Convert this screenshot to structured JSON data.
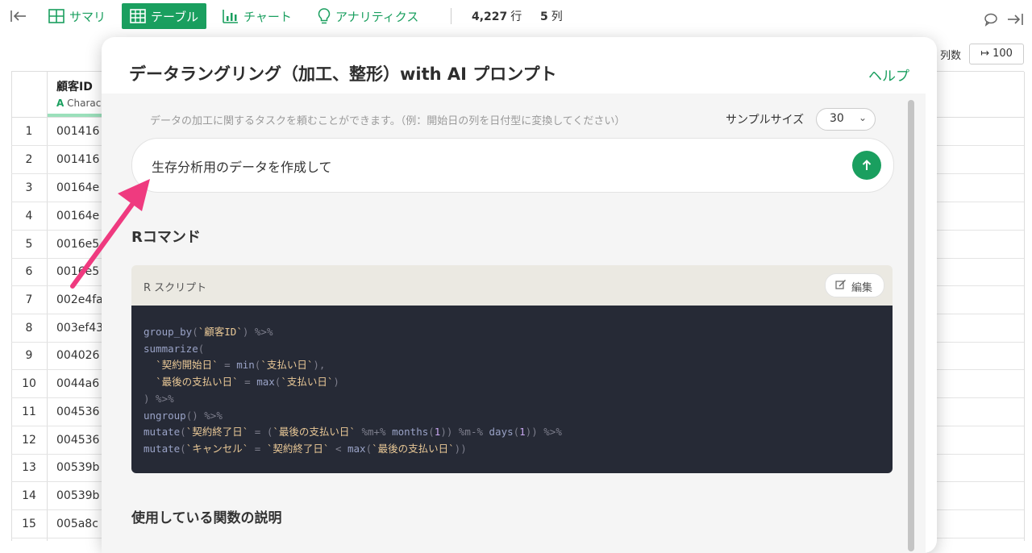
{
  "toolbar": {
    "summary_label": "サマリ",
    "table_label": "テーブル",
    "chart_label": "チャート",
    "analytics_label": "アナリティクス",
    "rows_value": "4,227",
    "rows_unit": "行",
    "cols_value": "5",
    "cols_unit": "列",
    "accent_color": "#1a9f5f"
  },
  "table": {
    "column_header": "顧客ID",
    "column_type": "Charac",
    "column_count_label": "列数",
    "column_count_button": "↦ 100",
    "rows": [
      {
        "num": "1",
        "val": "001416"
      },
      {
        "num": "2",
        "val": "001416"
      },
      {
        "num": "3",
        "val": "00164e"
      },
      {
        "num": "4",
        "val": "00164e"
      },
      {
        "num": "5",
        "val": "0016e5"
      },
      {
        "num": "6",
        "val": "0016e5"
      },
      {
        "num": "7",
        "val": "002e4fa"
      },
      {
        "num": "8",
        "val": "003ef43"
      },
      {
        "num": "9",
        "val": "004026"
      },
      {
        "num": "10",
        "val": "0044a6"
      },
      {
        "num": "11",
        "val": "004536"
      },
      {
        "num": "12",
        "val": "004536"
      },
      {
        "num": "13",
        "val": "00539b"
      },
      {
        "num": "14",
        "val": "00539b"
      },
      {
        "num": "15",
        "val": "005a8c"
      }
    ]
  },
  "modal": {
    "title": "データラングリング（加工、整形）with AI プロンプト",
    "help_link": "ヘルプ",
    "hint": "データの加工に関するタスクを頼むことができます。（例：開始日の列を日付型に変換してください）",
    "sample_size_label": "サンプルサイズ",
    "sample_size_value": "30",
    "prompt_text": "生存分析用のデータを作成して",
    "r_command_heading": "Rコマンド",
    "script_label": "R スクリプト",
    "edit_button": "編集",
    "functions_heading": "使用している関数の説明"
  }
}
